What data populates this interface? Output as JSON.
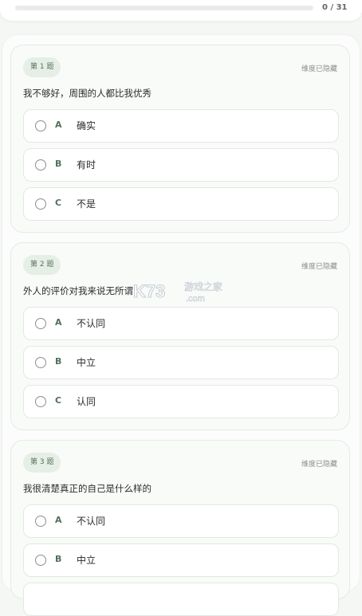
{
  "progress": {
    "text": "0 / 31",
    "fraction": 0.0
  },
  "questions": [
    {
      "badge": "第 1 题",
      "hidden_label": "维度已隐藏",
      "text": "我不够好，周围的人都比我优秀",
      "options": [
        {
          "letter": "A",
          "text": "确实"
        },
        {
          "letter": "B",
          "text": "有时"
        },
        {
          "letter": "C",
          "text": "不是"
        }
      ]
    },
    {
      "badge": "第 2 题",
      "hidden_label": "维度已隐藏",
      "text": "外人的评价对我来说无所谓",
      "options": [
        {
          "letter": "A",
          "text": "不认同"
        },
        {
          "letter": "B",
          "text": "中立"
        },
        {
          "letter": "C",
          "text": "认同"
        }
      ]
    },
    {
      "badge": "第 3 题",
      "hidden_label": "维度已隐藏",
      "text": "我很清楚真正的自己是什么样的",
      "options": [
        {
          "letter": "A",
          "text": "不认同"
        },
        {
          "letter": "B",
          "text": "中立"
        }
      ]
    }
  ],
  "watermark": {
    "logo": "K73",
    "text": "游戏之家",
    "domain": ".com"
  }
}
